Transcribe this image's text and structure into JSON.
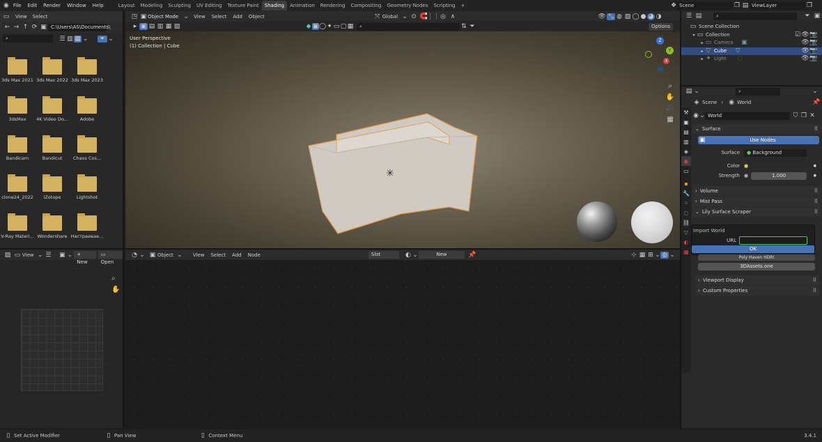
{
  "topbar": {
    "menus": [
      "File",
      "Edit",
      "Render",
      "Window",
      "Help"
    ],
    "workspaces": [
      "Layout",
      "Modeling",
      "Sculpting",
      "UV Editing",
      "Texture Paint",
      "Shading",
      "Animation",
      "Rendering",
      "Compositing",
      "Geometry Nodes",
      "Scripting"
    ],
    "add_workspace": "+",
    "scene_label": "Scene",
    "view_layer_label": "ViewLayer"
  },
  "file_browser": {
    "view_label": "View",
    "select_label": "Select",
    "path": "C:\\Users\\AS\\Documents\\",
    "items": [
      "3ds Max 2021",
      "3ds Max 2022",
      "3ds Max 2023",
      "3dsMax",
      "4K Video Do...",
      "Adobe",
      "Bandicam",
      "Bandicut",
      "Chaos Cos...",
      "clone24_2022",
      "iZotope",
      "Lightshot",
      "V-Ray Materi...",
      "Wondershare",
      "Настраивае..."
    ]
  },
  "viewport": {
    "mode": "Object Mode",
    "menus": [
      "View",
      "Select",
      "Add",
      "Object"
    ],
    "transform": "Global",
    "options_label": "Options",
    "info_line1": "User Perspective",
    "info_line2": "(1) Collection | Cube",
    "gizmo_x": "X",
    "gizmo_y": "Y",
    "gizmo_z": "Z"
  },
  "image_editor": {
    "view_label": "View",
    "new_label": "New",
    "open_label": "Open"
  },
  "node_editor": {
    "object_label": "Object",
    "menus": [
      "View",
      "Select",
      "Add",
      "Node"
    ],
    "slot_label": "Slot",
    "new_label": "New"
  },
  "outliner": {
    "scene_collection": "Scene Collection",
    "collection": "Collection",
    "objects": [
      "Camera",
      "Cube",
      "Light"
    ]
  },
  "properties": {
    "breadcrumb_scene": "Scene",
    "breadcrumb_world": "World",
    "world_name": "World",
    "surface_panel": "Surface",
    "use_nodes": "Use Nodes",
    "surface_label": "Surface",
    "surface_value": "Background",
    "color_label": "Color",
    "strength_label": "Strength",
    "strength_value": "1.000",
    "volume_panel": "Volume",
    "mist_panel": "Mist Pass",
    "lily_panel": "Lily Surface Scraper",
    "import_world": "Import World",
    "url_label": "URL",
    "ok_label": "OK",
    "poly_haven": "Poly Haven HDRI",
    "assets_button": "3DAssets.one",
    "viewport_display": "Viewport Display",
    "custom_properties": "Custom Properties"
  },
  "statusbar": {
    "left": "Set Active Modifier",
    "middle": "Pan View",
    "right": "Context Menu",
    "version": "3.4.1"
  },
  "colors": {
    "accent_blue": "#4772b3",
    "selection_orange": "#e8933a",
    "url_green": "#3fcf3f",
    "folder_yellow": "#d4b15e"
  }
}
